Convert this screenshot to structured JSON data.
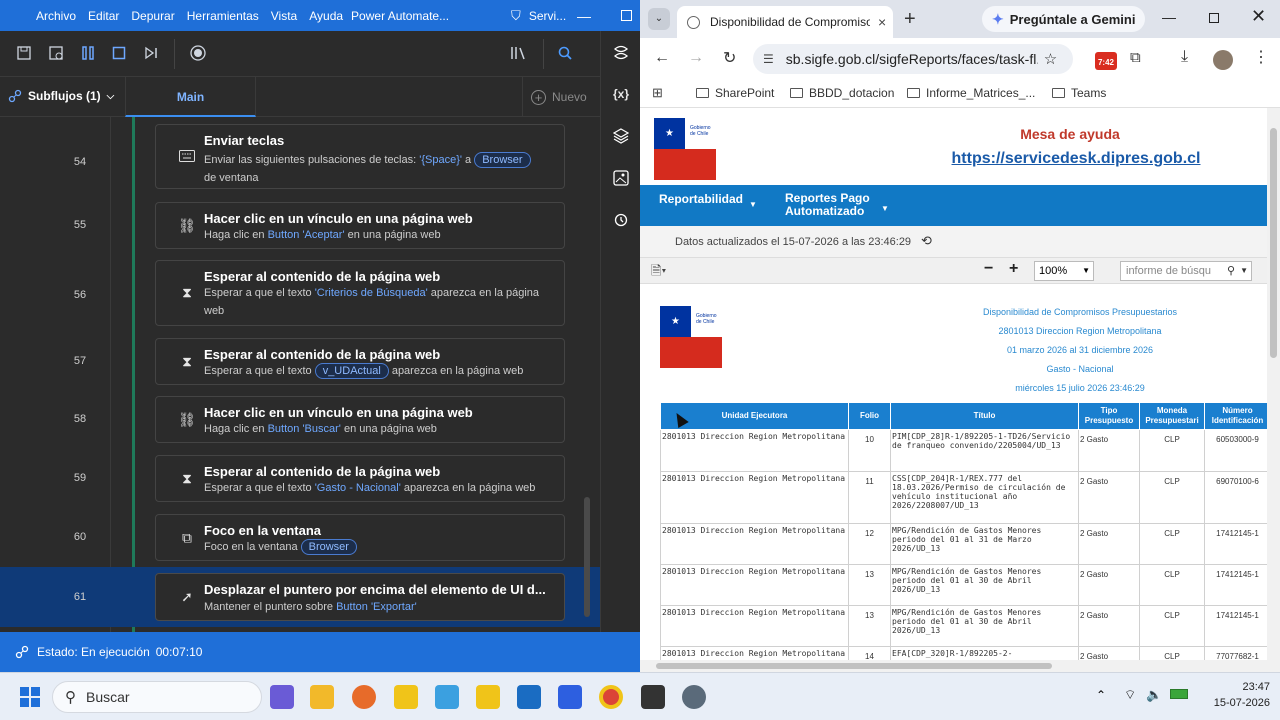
{
  "power_automate": {
    "menu": [
      "Archivo",
      "Editar",
      "Depurar",
      "Herramientas",
      "Vista",
      "Ayuda"
    ],
    "app_title": "Power Automate...",
    "title_extra": "Servi...",
    "subflows_label": "Subflujos (1)",
    "tab_main": "Main",
    "new_label": "Nuevo",
    "steps": [
      {
        "num": "54",
        "title": "Enviar teclas",
        "desc_parts": [
          "Enviar las siguientes pulsaciones de teclas: ",
          "'{Space}'",
          " a ",
          "Browser",
          " de ventana"
        ],
        "icon": "keyboard-icon"
      },
      {
        "num": "55",
        "title": "Hacer clic en un vínculo en una página web",
        "desc_parts": [
          "Haga clic en ",
          "Button 'Aceptar'",
          " en una página web"
        ],
        "icon": "link-icon"
      },
      {
        "num": "56",
        "title": "Esperar al contenido de la página web",
        "desc_parts": [
          "Esperar a que el texto ",
          "'Criterios de Búsqueda'",
          " aparezca en la página web"
        ],
        "icon": "hourglass-icon"
      },
      {
        "num": "57",
        "title": "Esperar al contenido de la página web",
        "desc_parts": [
          "Esperar a que el texto ",
          "v_UDActual",
          " aparezca en la página web"
        ],
        "icon": "hourglass-icon"
      },
      {
        "num": "58",
        "title": "Hacer clic en un vínculo en una página web",
        "desc_parts": [
          "Haga clic en ",
          "Button 'Buscar'",
          " en una página web"
        ],
        "icon": "link-icon"
      },
      {
        "num": "59",
        "title": "Esperar al contenido de la página web",
        "desc_parts": [
          "Esperar a que el texto ",
          "'Gasto - Nacional'",
          " aparezca en la página web"
        ],
        "icon": "hourglass-icon"
      },
      {
        "num": "60",
        "title": "Foco en la ventana",
        "desc_parts": [
          "Foco en la ventana ",
          "Browser"
        ],
        "icon": "window-focus-icon"
      },
      {
        "num": "61",
        "title": "Desplazar el puntero por encima del elemento de UI d...",
        "desc_parts": [
          "Mantener el puntero sobre ",
          "Button 'Exportar'"
        ],
        "icon": "pointer-icon"
      }
    ],
    "status_label": "Estado: En ejecución",
    "status_time": "00:07:10"
  },
  "chrome": {
    "tab_title": "Disponibilidad de Compromiso",
    "gemini_label": "Pregúntale a Gemini",
    "url": "sb.sigfe.gob.cl/sigfeReports/faces/task-fl...",
    "ext_badge": "7:42",
    "bookmarks": [
      "SharePoint",
      "BBDD_dotacion",
      "Informe_Matrices_...",
      "Teams"
    ]
  },
  "site": {
    "logo_text": "Gobierno de Chile",
    "help_title": "Mesa de ayuda",
    "help_link": "https://servicedesk.dipres.gob.cl",
    "nav1": "Reportabilidad",
    "nav2_line1": "Reportes Pago",
    "nav2_line2": "Automatizado",
    "updated": "Datos actualizados el 15-07-2026 a las 23:46:29",
    "zoom": "100%",
    "search_placeholder": "informe de búsqu"
  },
  "report": {
    "title": "Disponibilidad de Compromisos Presupuestarios",
    "unit": "2801013 Direccion Region Metropolitana",
    "period": "01 marzo 2026 al 31 diciembre 2026",
    "type": "Gasto - Nacional",
    "date": "miércoles 15 julio 2026 23:46:29",
    "columns": [
      "Unidad Ejecutora",
      "Folio",
      "Título",
      "Tipo Presupuesto",
      "Moneda Presupuestari",
      "Número Identificación"
    ],
    "rows": [
      [
        "2801013 Direccion Region Metropolitana",
        "10",
        "PIM[CDP_28]R-1/892205-1-TD26/Servicio de franqueo convenido/2205004/UD_13",
        "2 Gasto",
        "CLP",
        "60503000-9"
      ],
      [
        "2801013 Direccion Region Metropolitana",
        "11",
        "CSS[CDP_204]R-1/REX.777 del 18.03.2026/Permiso de circulación de vehículo institucional año 2026/2208007/UD_13",
        "2 Gasto",
        "CLP",
        "69070100-6"
      ],
      [
        "2801013 Direccion Region Metropolitana",
        "12",
        "MPG/Rendición de Gastos Menores periodo del 01 al 31 de Marzo 2026/UD_13",
        "2 Gasto",
        "CLP",
        "17412145-1"
      ],
      [
        "2801013 Direccion Region Metropolitana",
        "13",
        "MPG/Rendición de Gastos Menores periodo del 01 al 30 de Abril 2026/UD_13",
        "2 Gasto",
        "CLP",
        "17412145-1"
      ],
      [
        "2801013 Direccion Region Metropolitana",
        "13",
        "MPG/Rendición de Gastos Menores periodo del 01 al 30 de Abril 2026/UD_13",
        "2 Gasto",
        "CLP",
        "17412145-1"
      ],
      [
        "2801013 Direccion Region Metropolitana",
        "14",
        "EFA[CDP_320]R-1/892205-2-",
        "2 Gasto",
        "CLP",
        "77077682-1"
      ]
    ]
  },
  "taskbar": {
    "search_placeholder": "Buscar",
    "time": "23:47",
    "date": "15-07-2026"
  }
}
